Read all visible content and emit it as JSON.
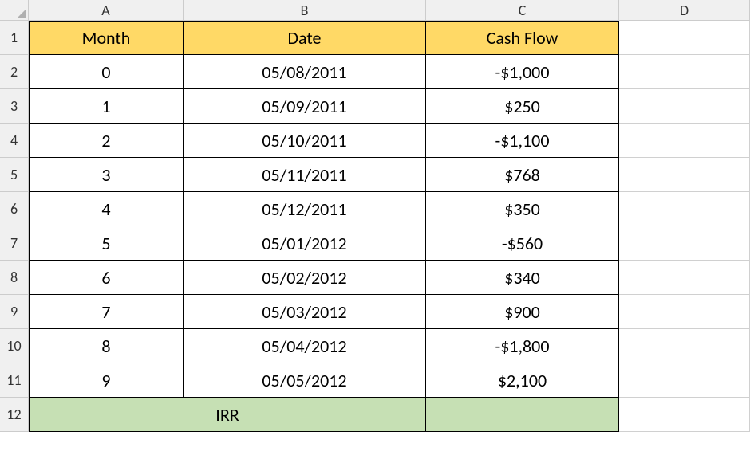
{
  "columns": {
    "a": "A",
    "b": "B",
    "c": "C",
    "d": "D"
  },
  "row_labels": [
    "1",
    "2",
    "3",
    "4",
    "5",
    "6",
    "7",
    "8",
    "9",
    "10",
    "11",
    "12"
  ],
  "headers": {
    "month": "Month",
    "date": "Date",
    "cashflow": "Cash Flow"
  },
  "rows": [
    {
      "month": "0",
      "date": "05/08/2011",
      "cashflow": "-$1,000"
    },
    {
      "month": "1",
      "date": "05/09/2011",
      "cashflow": "$250"
    },
    {
      "month": "2",
      "date": "05/10/2011",
      "cashflow": "-$1,100"
    },
    {
      "month": "3",
      "date": "05/11/2011",
      "cashflow": "$768"
    },
    {
      "month": "4",
      "date": "05/12/2011",
      "cashflow": "$350"
    },
    {
      "month": "5",
      "date": "05/01/2012",
      "cashflow": "-$560"
    },
    {
      "month": "6",
      "date": "05/02/2012",
      "cashflow": "$340"
    },
    {
      "month": "7",
      "date": "05/03/2012",
      "cashflow": "$900"
    },
    {
      "month": "8",
      "date": "05/04/2012",
      "cashflow": "-$1,800"
    },
    {
      "month": "9",
      "date": "05/05/2012",
      "cashflow": "$2,100"
    }
  ],
  "footer": {
    "irr_label": "IRR",
    "irr_value": ""
  }
}
